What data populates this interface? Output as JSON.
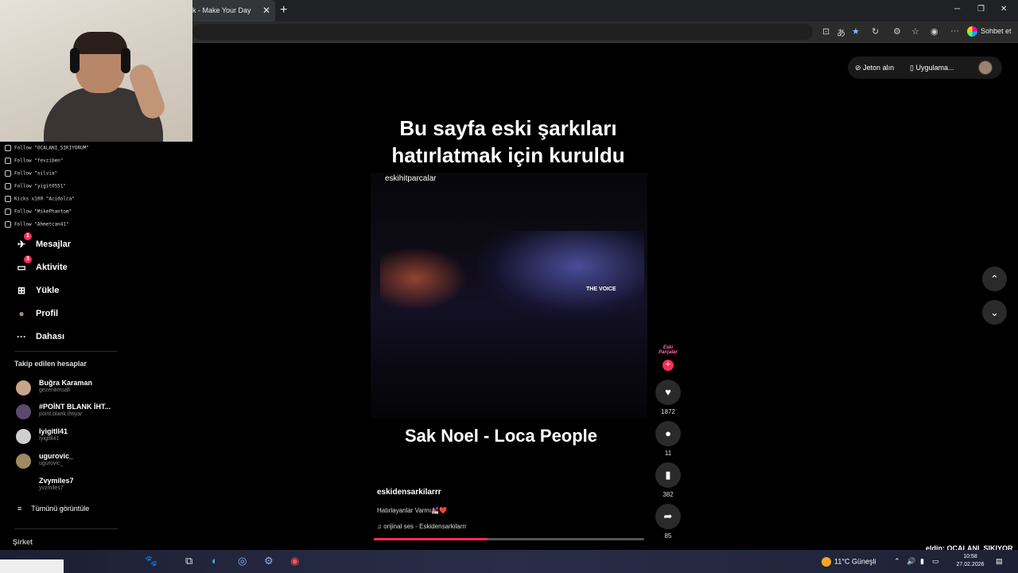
{
  "browser": {
    "tab_title": "k - Make Your Day",
    "tab_close": "✕",
    "new_tab": "+",
    "chat_label": "Sohbet et"
  },
  "stream_overlay": {
    "alerts": [
      "Follow \"OCALANI_SIKIYORUM\"",
      "Follow \"fevziben\"",
      "Follow \"silvia\"",
      "Follow \"yigit0551\"",
      "Kicks x100 \"Acidolca\"",
      "Follow \"MikePhantom\"",
      "Follow \"Ahmetcan41\""
    ],
    "ticker": "eldin: OCALANI_SIKIYOR"
  },
  "sidebar": {
    "nav": [
      {
        "label": "Mesajlar",
        "icon": "send-icon",
        "glyph": "✈",
        "badge": "1"
      },
      {
        "label": "Aktivite",
        "icon": "activity-icon",
        "glyph": "▭",
        "badge": "3"
      },
      {
        "label": "Yükle",
        "icon": "upload-icon",
        "glyph": "⊞",
        "badge": ""
      },
      {
        "label": "Profil",
        "icon": "profile-avatar-icon",
        "glyph": "●",
        "badge": ""
      },
      {
        "label": "Dahası",
        "icon": "more-icon",
        "glyph": "···",
        "badge": ""
      }
    ],
    "following_heading": "Takip edilen hesaplar",
    "accounts": [
      {
        "name": "Buğra Karaman",
        "handle": "gezentimsafi"
      },
      {
        "name": "#POİNT BLANK İHT...",
        "handle": "point.blank.ihtiyar"
      },
      {
        "name": "Iyigitll41",
        "handle": "Iyigitll41"
      },
      {
        "name": "ugurovic_",
        "handle": "ugurovic_"
      },
      {
        "name": "Zvymiles7",
        "handle": "yvzmiles7"
      }
    ],
    "see_all": "Tümünü görüntüle",
    "company": "Şirket"
  },
  "top_right": {
    "coins": "Jeton alın",
    "app": "Uygulama..."
  },
  "video": {
    "overlay_title_line1": "Bu sayfa eski şarkıları",
    "overlay_title_line2": "hatırlatmak için kuruldu",
    "watermark": "eskihitparcalar",
    "stage_sign": "THE VOICE",
    "song_title": "Sak Noel - Loca People",
    "author": "eskidensarkilarrr",
    "caption": "Hatırlayanlar Varmı💒❤️",
    "music": "orijinal ses - Eskidensarkilarrr",
    "progress": 0.42
  },
  "actions": {
    "creator_badge": "Eski Parçalar",
    "likes": "1872",
    "comments": "11",
    "saves": "382",
    "shares": "85"
  },
  "taskbar": {
    "weather": "11°C Güneşli",
    "time": "10:58",
    "date": "27.02.2026"
  },
  "colors": {
    "accent": "#fe2c55",
    "background": "#000000"
  }
}
